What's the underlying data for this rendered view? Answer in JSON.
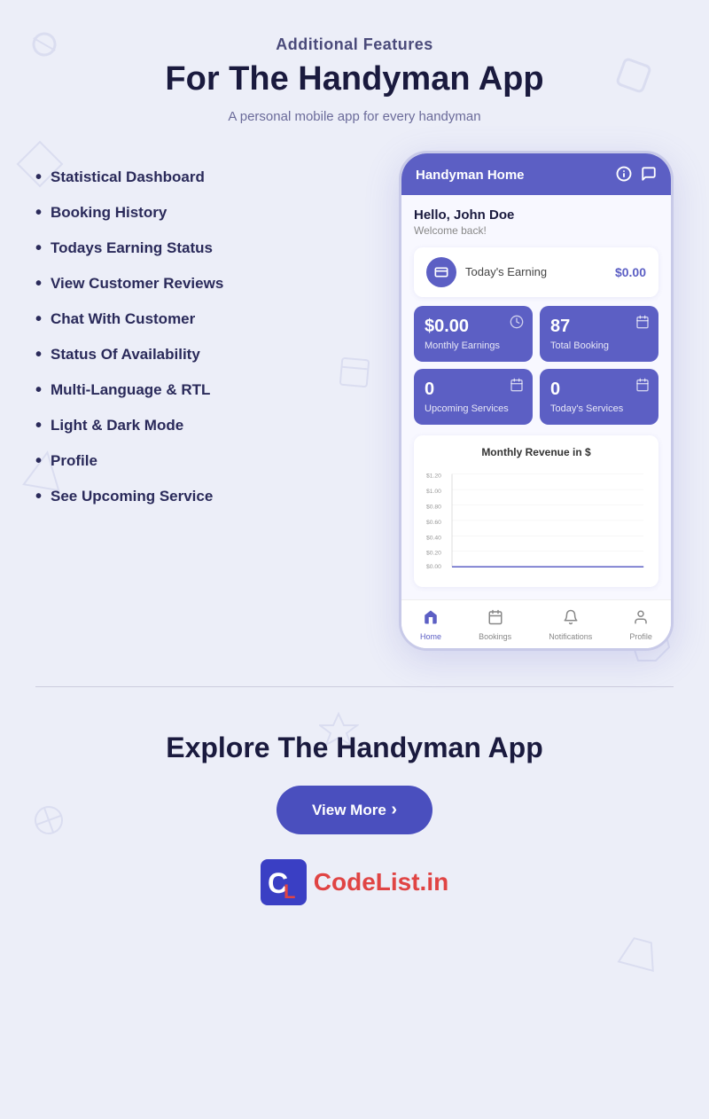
{
  "header": {
    "subtitle": "Additional Features",
    "title": "For The Handyman App",
    "description": "A personal mobile app for every handyman"
  },
  "features": [
    "Statistical Dashboard",
    "Booking History",
    "Todays Earning Status",
    "View Customer Reviews",
    "Chat With Customer",
    "Status Of Availability",
    "Multi-Language & RTL",
    "Light & Dark Mode",
    "Profile",
    "See Upcoming Service"
  ],
  "phone": {
    "header_title": "Handyman Home",
    "greeting_name": "Hello, John Doe",
    "greeting_sub": "Welcome back!",
    "earning_label": "Today's Earning",
    "earning_value": "$0.00",
    "stats": [
      {
        "number": "$0.00",
        "label": "Monthly Earnings"
      },
      {
        "number": "87",
        "label": "Total Booking"
      },
      {
        "number": "0",
        "label": "Upcoming Services"
      },
      {
        "number": "0",
        "label": "Today's Services"
      }
    ],
    "chart_title": "Monthly Revenue in $",
    "chart_y_labels": [
      "$1.20",
      "$1.00",
      "$0.80",
      "$0.60",
      "$0.40",
      "$0.20",
      "$0.00"
    ],
    "nav": [
      {
        "label": "Home",
        "active": true
      },
      {
        "label": "Bookings",
        "active": false
      },
      {
        "label": "Notifications",
        "active": false
      },
      {
        "label": "Profile",
        "active": false
      }
    ]
  },
  "bottom": {
    "explore_title": "Explore The Handyman App",
    "view_more_label": "View More",
    "logo_text": "CodeList.in"
  }
}
